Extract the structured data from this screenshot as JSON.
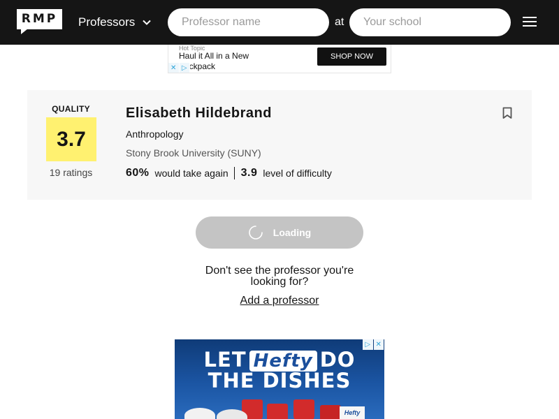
{
  "header": {
    "logo_text": "RMP",
    "dropdown_label": "Professors",
    "professor_placeholder": "Professor name",
    "at_label": "at",
    "school_placeholder": "Your school"
  },
  "ad_top": {
    "brand": "Hot Topic",
    "tagline": "Haul it All in a New Backpack",
    "cta": "SHOP NOW"
  },
  "professor": {
    "quality_label": "QUALITY",
    "score": "3.7",
    "ratings_count": "19 ratings",
    "name": "Elisabeth Hildebrand",
    "department": "Anthropology",
    "school": "Stony Brook University (SUNY)",
    "would_take_again_pct": "60%",
    "would_take_again_label": "would take again",
    "difficulty": "3.9",
    "difficulty_label": "level of difficulty"
  },
  "loading": {
    "label": "Loading"
  },
  "footer_prompt": {
    "message": "Don't see the professor you're looking for?",
    "add_link": "Add a professor"
  },
  "ad_bottom": {
    "line1_a": "LET",
    "brand": "Hefty",
    "line1_b": "DO",
    "line2": "THE DISHES",
    "box_label": "Hefty"
  },
  "colors": {
    "header_bg": "#151515",
    "quality_yellow": "#fff170",
    "card_bg": "#f7f7f7",
    "loading_bg": "#c4c4c4"
  }
}
